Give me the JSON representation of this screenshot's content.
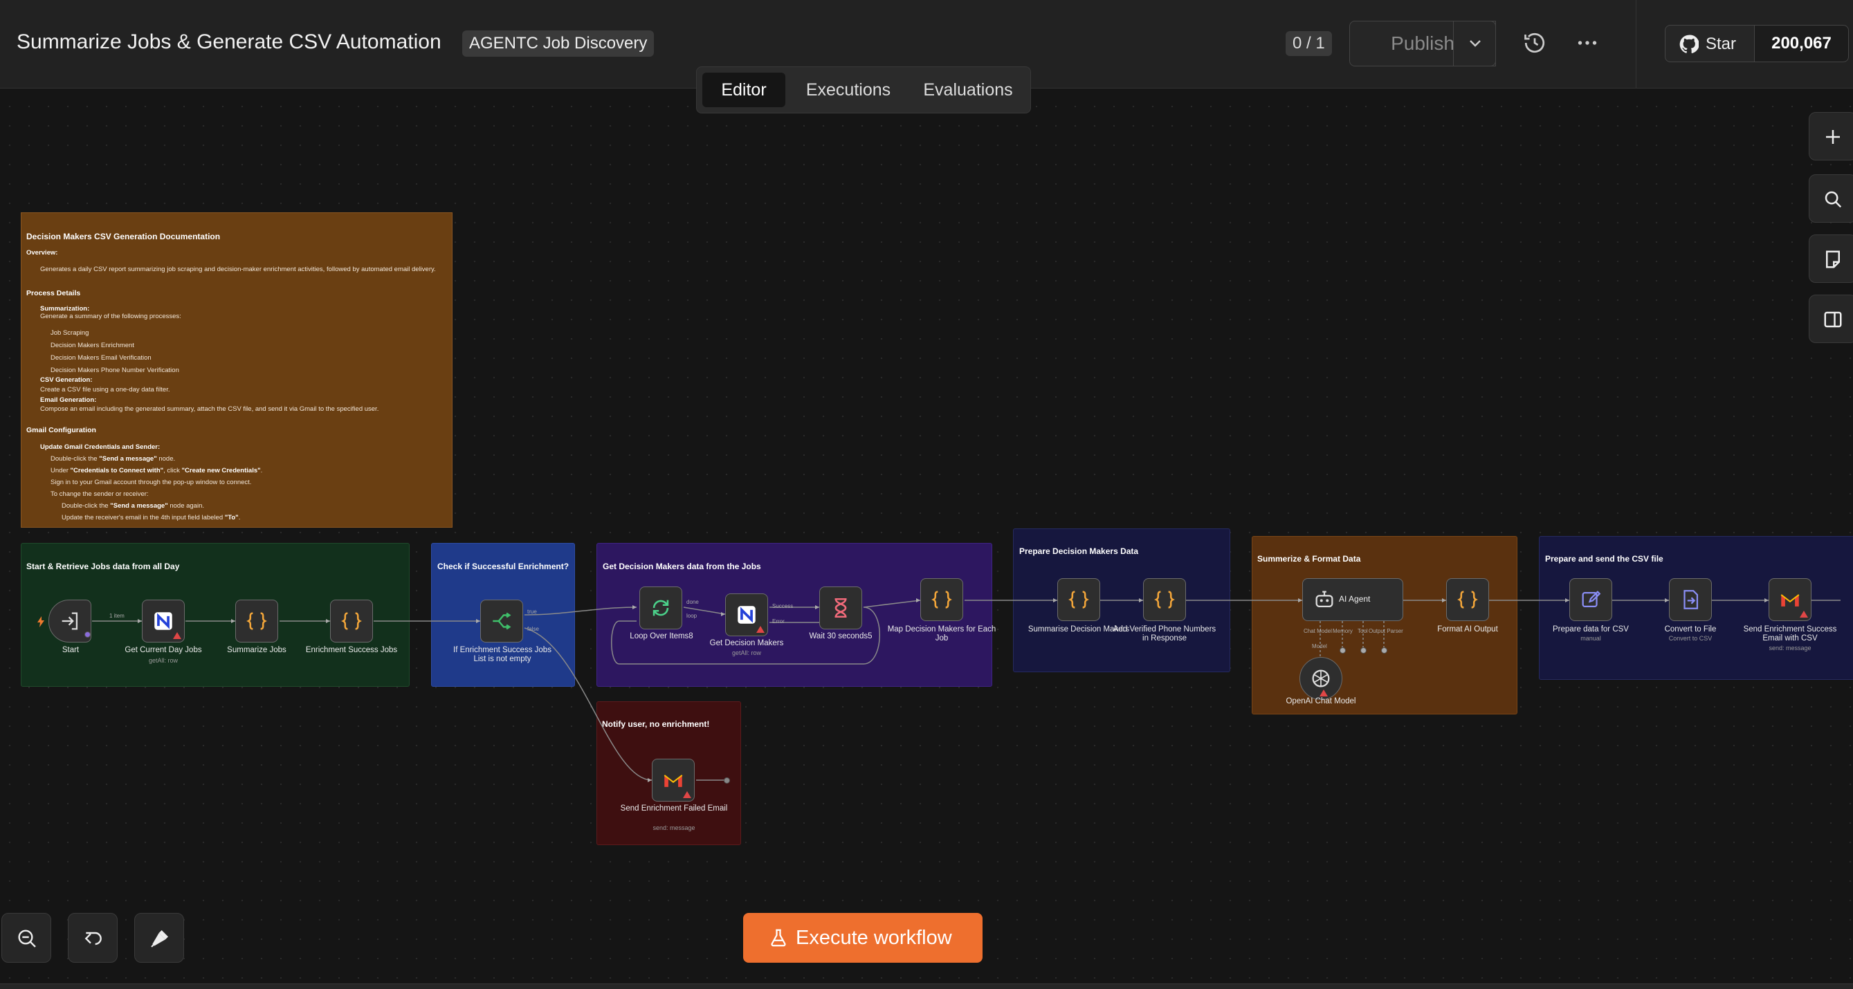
{
  "header": {
    "title": "Summarize Jobs & Generate CSV Automation",
    "tag": "AGENTC Job Discovery",
    "counter": "0 / 1",
    "publish_label": "Publish",
    "github_star_label": "Star",
    "github_star_count": "200,067"
  },
  "tabs": [
    "Editor",
    "Executions",
    "Evaluations"
  ],
  "active_tab": "Editor",
  "sticky_notes": {
    "documentation": {
      "title": "Decision Makers CSV Generation Documentation",
      "overview_heading": "Overview:",
      "overview_text": "Generates a daily CSV report summarizing job scraping and decision-maker enrichment activities, followed by automated email delivery.",
      "process_heading": "Process Details",
      "summarization_heading": "Summarization:",
      "summarization_text": "Generate a summary of the following processes:",
      "processes": [
        "Job Scraping",
        "Decision Makers Enrichment",
        "Decision Makers Email Verification",
        "Decision Makers Phone Number Verification"
      ],
      "csv_heading": "CSV Generation:",
      "csv_text": "Create a CSV file using a one-day data filter.",
      "email_heading": "Email Generation:",
      "email_text": "Compose an email including the generated summary, attach the CSV file, and send it via Gmail to the specified user.",
      "gmail_heading": "Gmail Configuration",
      "update_heading": "Update Gmail Credentials and Sender:",
      "step1_pre": "Double-click the ",
      "step1_bold": "\"Send a message\"",
      "step1_post": " node.",
      "step2_pre": "Under ",
      "step2_bold1": "\"Credentials to Connect with\"",
      "step2_mid": ", click ",
      "step2_bold2": "\"Create new Credentials\"",
      "step2_post": ".",
      "step3": "Sign in to your Gmail account through the pop-up window to connect.",
      "step4": "To change the sender or receiver:",
      "step5_pre": "Double-click the ",
      "step5_bold": "\"Send a message\"",
      "step5_post": " node again.",
      "step6_pre": "Update the receiver's email in the 4th input field labeled ",
      "step6_bold": "\"To\"",
      "step6_post": "."
    },
    "start_group": "Start & Retrieve Jobs data from all Day",
    "check_group": "Check if Successful Enrichment?",
    "decision_group": "Get Decision Makers data from the Jobs",
    "notify_group": "Notify user, no enrichment!",
    "prepare_group": "Prepare Decision Makers Data",
    "format_group": "Summerize & Format Data",
    "csv_group": "Prepare and send the CSV file"
  },
  "nodes": {
    "start": {
      "label": "Start"
    },
    "get_current_day_jobs": {
      "label": "Get Current Day Jobs",
      "sub": "getAll: row"
    },
    "summarize_jobs": {
      "label": "Summarize Jobs"
    },
    "enrichment_success_jobs": {
      "label": "Enrichment Success Jobs"
    },
    "if_enrichment": {
      "label": "If Enrichment Success Jobs List is not empty"
    },
    "loop_over_items": {
      "label": "Loop Over Items8"
    },
    "get_decision_makers": {
      "label": "Get Decision Makers",
      "sub": "getAll: row"
    },
    "wait": {
      "label": "Wait 30 seconds5"
    },
    "map_decision_makers": {
      "label": "Map Decision Makers for Each Job"
    },
    "send_failed_email": {
      "label": "Send Enrichment Failed Email",
      "sub": "send: message"
    },
    "summarise_decision_makers": {
      "label": "Summarise Decision Makers"
    },
    "add_verified_phone": {
      "label": "Add Verified Phone Numbers in Response"
    },
    "ai_agent": {
      "label": "AI Agent"
    },
    "openai_model": {
      "label": "OpenAI Chat Model"
    },
    "format_ai_output": {
      "label": "Format AI Output"
    },
    "prepare_csv": {
      "label": "Prepare data for CSV",
      "sub": "manual"
    },
    "convert_to_file": {
      "label": "Convert to File",
      "sub": "Convert to CSV"
    },
    "send_success_email": {
      "label": "Send Enrichment Success Email with CSV",
      "sub": "send: message"
    }
  },
  "edge_labels": {
    "one_item": "1 item",
    "true": "true",
    "false": "false",
    "done": "done",
    "loop": "loop",
    "success": "Success",
    "error": "Error",
    "chat_model": "Chat Model",
    "memory": "Memory",
    "tool": "Tool",
    "output_parser": "Output Parser",
    "model": "Model"
  },
  "footer": {
    "execute_label": "Execute workflow"
  },
  "colors": {
    "accent": "#ee6f2e",
    "doc_note": "#6a3f12",
    "green_group": "#12301c",
    "blue_group": "#1f3a8a",
    "purple_group": "#2d1760",
    "red_group": "#3e0f10",
    "navy_group": "#16173e",
    "orange_group": "#5a310f"
  }
}
